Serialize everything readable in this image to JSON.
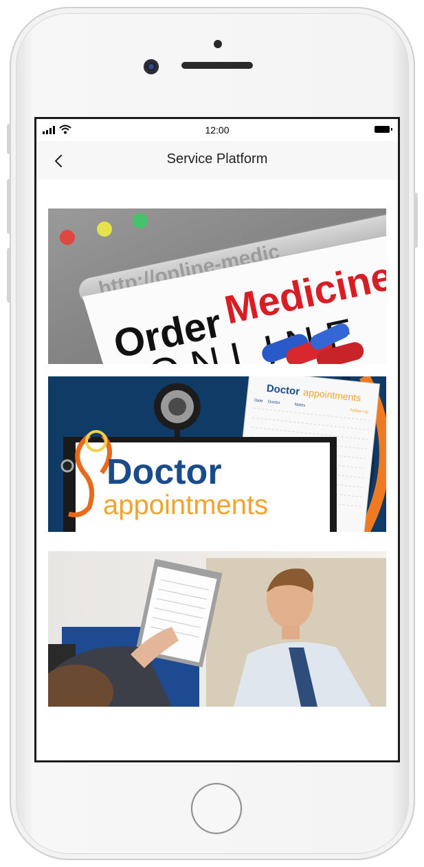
{
  "status_bar": {
    "time": "12:00"
  },
  "nav": {
    "title": "Service Platform",
    "back_icon": "chevron-left-icon"
  },
  "cards": [
    {
      "name": "order-medicine-online",
      "url_text": "http://online-medic",
      "word1": "Order",
      "word2": "Medicine",
      "word3": "ONLINE"
    },
    {
      "name": "doctor-appointments",
      "title": "Doctor",
      "subtitle": "appointments",
      "sheet_title": "Doctor",
      "sheet_subtitle": "appointments",
      "sheet_col_date": "Date",
      "sheet_col_doctor": "Doctor",
      "sheet_col_notes": "Notes",
      "sheet_col_follow": "Follow Up"
    },
    {
      "name": "consultation-photo"
    }
  ],
  "colors": {
    "nav_bg": "#f7f7f7",
    "order_red": "#d81e24",
    "doctor_bg": "#0f3b66",
    "doctor_blue": "#1a4b8a",
    "appointments_orange": "#f3a32b"
  }
}
